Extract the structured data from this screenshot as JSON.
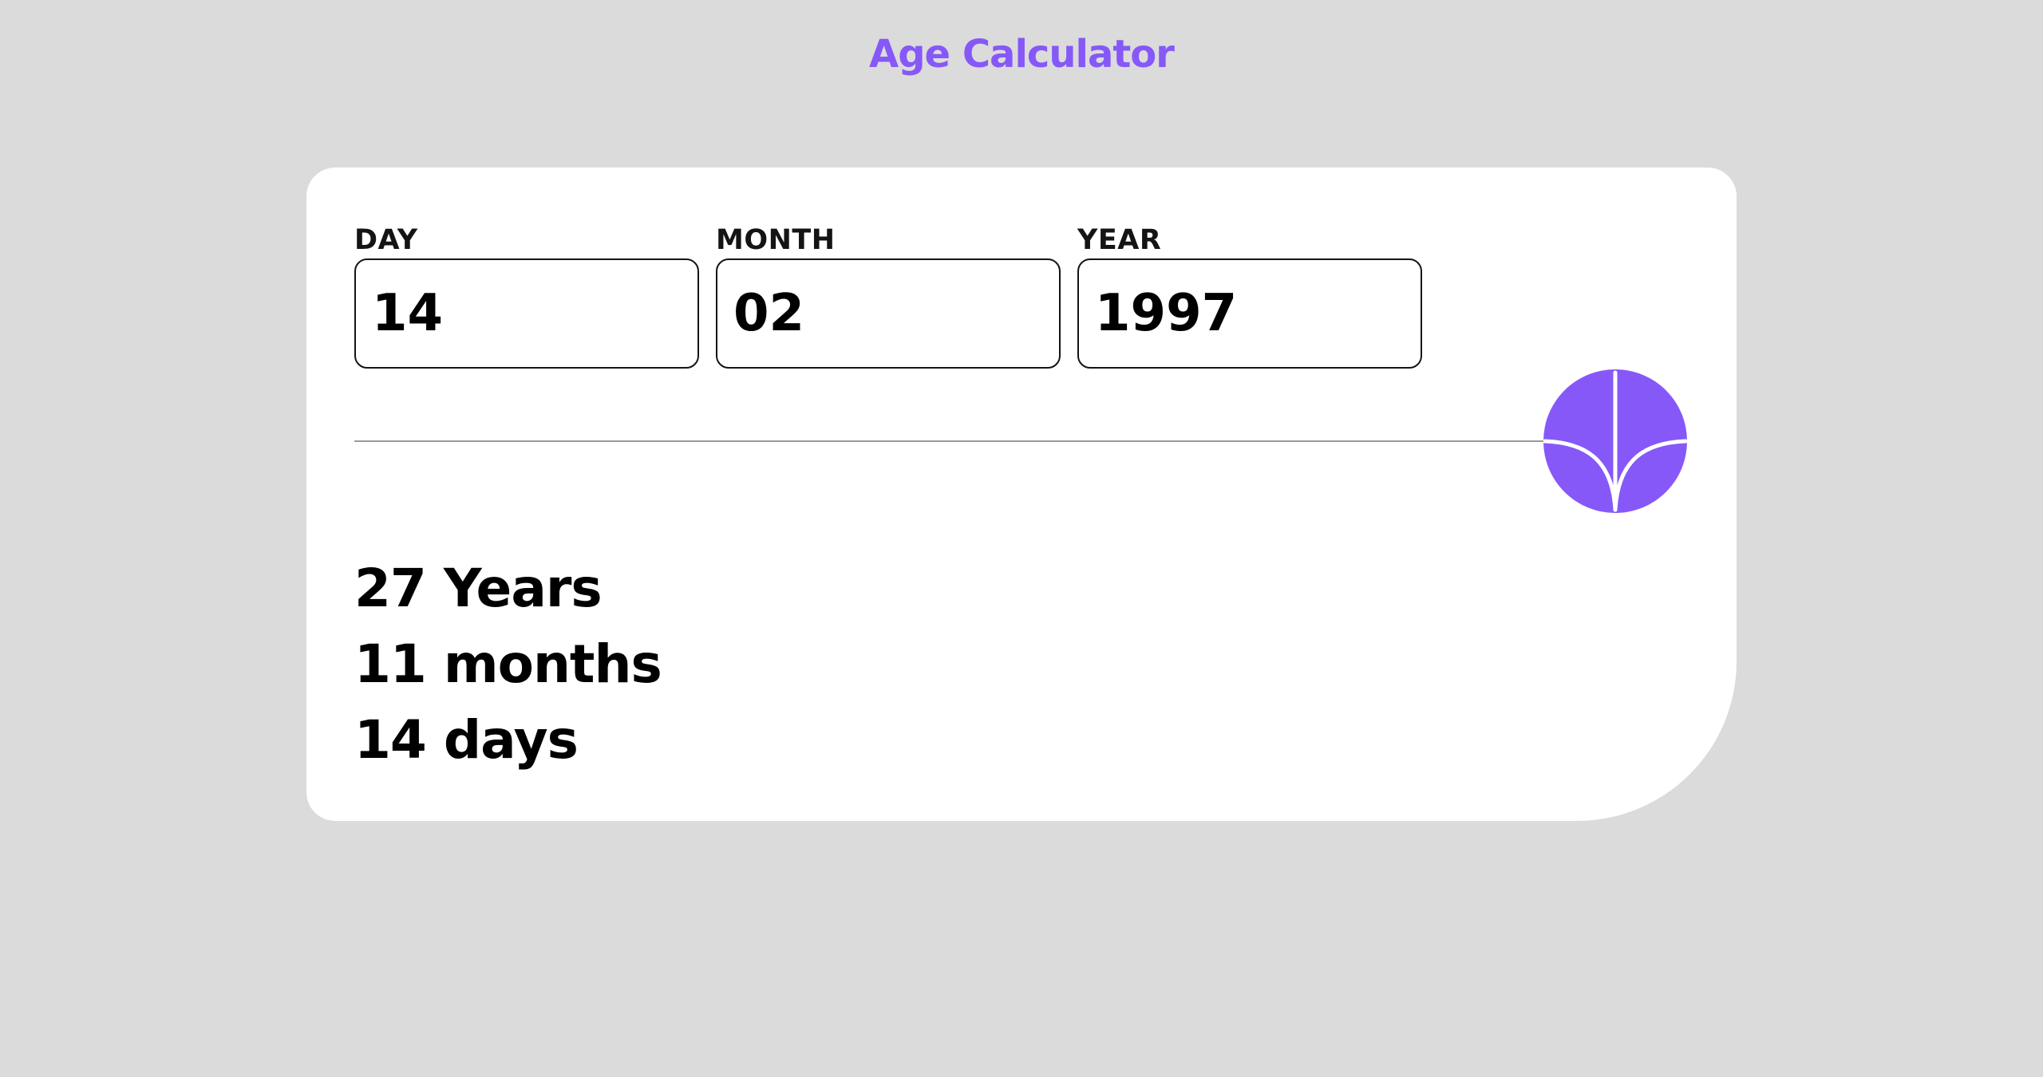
{
  "app": {
    "title": "Age Calculator"
  },
  "form": {
    "day": {
      "label": "DAY",
      "value": "14"
    },
    "month": {
      "label": "MONTH",
      "value": "02"
    },
    "year": {
      "label": "YEAR",
      "value": "1997"
    }
  },
  "submit": {
    "icon": "arrow-down-icon"
  },
  "result": {
    "years": "27 Years",
    "months": "11 months",
    "days": "14 days"
  },
  "colors": {
    "accent": "#8658f8",
    "background": "#dbdbdb",
    "card": "#ffffff",
    "text": "#000000"
  }
}
